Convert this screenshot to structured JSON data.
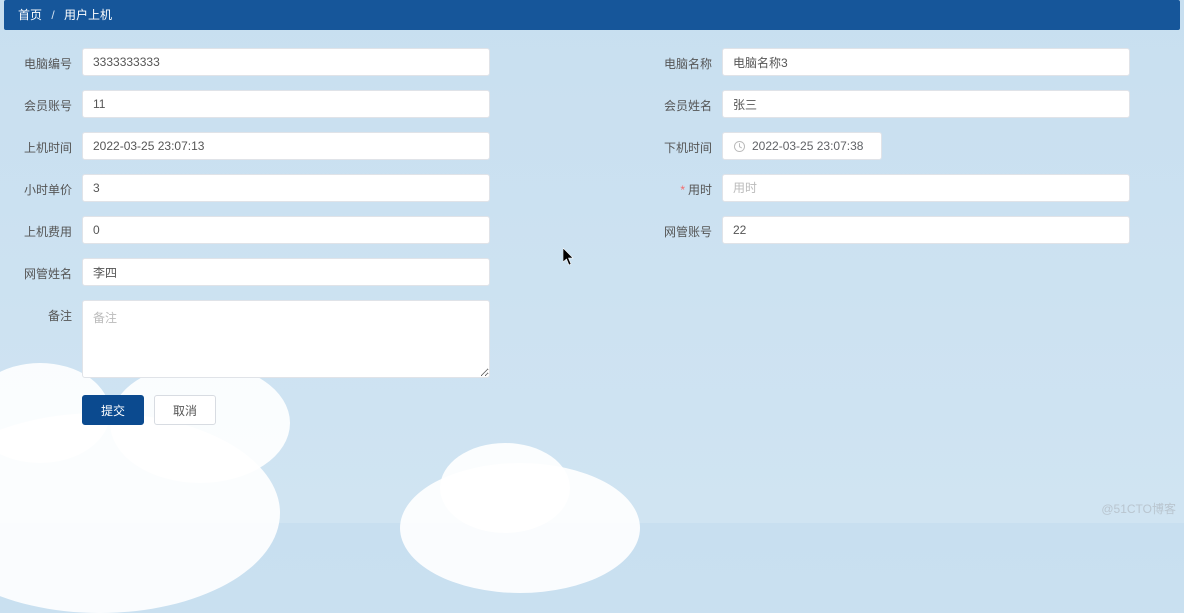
{
  "breadcrumb": {
    "home": "首页",
    "current": "用户上机"
  },
  "fields": {
    "computer_no": {
      "label": "电脑编号",
      "value": "3333333333"
    },
    "computer_name": {
      "label": "电脑名称",
      "value": "电脑名称3"
    },
    "member_acct": {
      "label": "会员账号",
      "value": "11"
    },
    "member_name": {
      "label": "会员姓名",
      "value": "张三"
    },
    "start_time": {
      "label": "上机时间",
      "value": "2022-03-25 23:07:13"
    },
    "end_time": {
      "label": "下机时间",
      "value": "2022-03-25 23:07:38"
    },
    "hour_price": {
      "label": "小时单价",
      "value": "3"
    },
    "duration": {
      "label": "用时",
      "placeholder": "用时",
      "required": true
    },
    "use_fee": {
      "label": "上机费用",
      "value": "0"
    },
    "admin_acct": {
      "label": "网管账号",
      "value": "22"
    },
    "admin_name": {
      "label": "网管姓名",
      "value": "李四"
    },
    "remark": {
      "label": "备注",
      "placeholder": "备注"
    }
  },
  "buttons": {
    "submit": "提交",
    "cancel": "取消"
  },
  "watermark": "@51CTO博客"
}
